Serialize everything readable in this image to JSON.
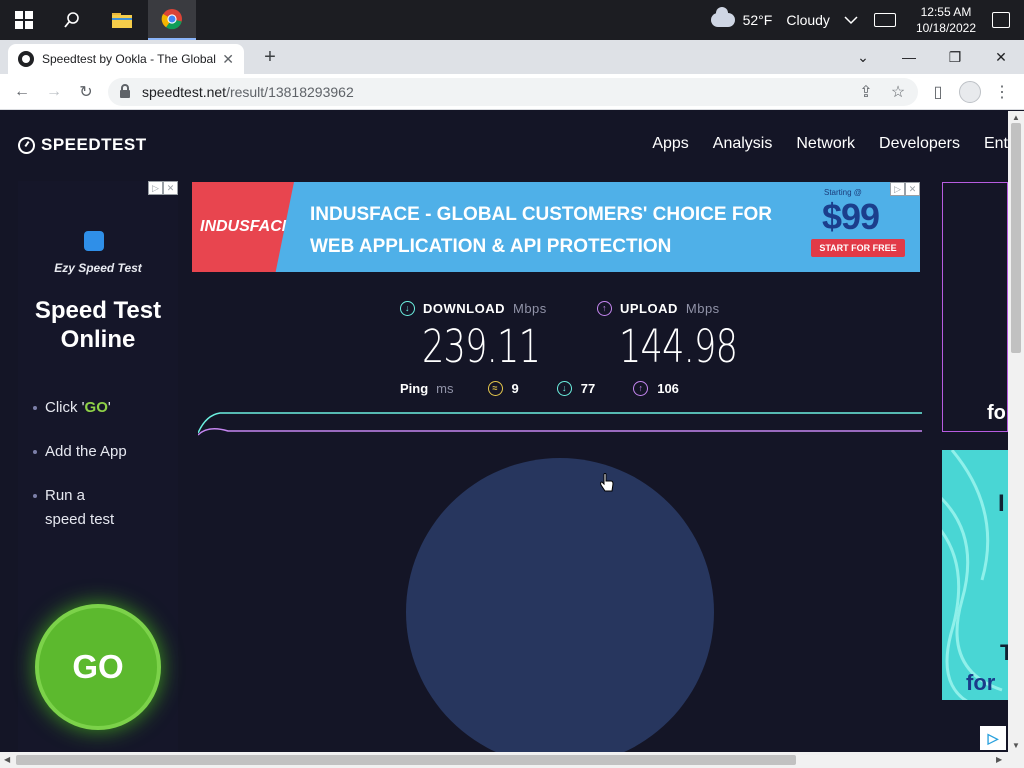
{
  "taskbar": {
    "weather": {
      "temp": "52°F",
      "condition": "Cloudy"
    },
    "clock": {
      "time": "12:55 AM",
      "date": "10/18/2022"
    }
  },
  "browser": {
    "tab_title": "Speedtest by Ookla - The Global Broadband Speed Test",
    "url_host": "speedtest.net",
    "url_path": "/result/13818293962"
  },
  "site": {
    "logo": "SPEEDTEST",
    "nav": [
      "Apps",
      "Analysis",
      "Network",
      "Developers",
      "Ent"
    ]
  },
  "left_ad": {
    "app_name": "Ezy Speed Test",
    "headline_1": "Speed Test",
    "headline_2": "Online",
    "step1_prefix": "Click '",
    "step1_go": "GO",
    "step1_suffix": "'",
    "step2": "Add the App",
    "step3_line1": "Run a",
    "step3_line2": "speed test",
    "go_label": "GO"
  },
  "banner": {
    "brand": "INDUSFACE",
    "line1": "INDUSFACE - GLOBAL CUSTOMERS' CHOICE FOR",
    "line2": "WEB APPLICATION & API PROTECTION",
    "starting_at": "Starting @",
    "price": "$99",
    "cta": "START FOR FREE"
  },
  "right_ads": {
    "ad1_text": "fo",
    "ad2_big": "I",
    "ad2_t": "T",
    "ad2_for": "for"
  },
  "results": {
    "download": {
      "label": "DOWNLOAD",
      "unit": "Mbps",
      "value": "239.11"
    },
    "upload": {
      "label": "UPLOAD",
      "unit": "Mbps",
      "value": "144.98"
    },
    "ping": {
      "label": "Ping",
      "unit": "ms",
      "jitter": "9",
      "down": "77",
      "up": "106"
    }
  },
  "colors": {
    "download": "#6cf0e0",
    "upload": "#c586f0",
    "go_green": "#5cb92e",
    "page_bg": "#141526"
  }
}
